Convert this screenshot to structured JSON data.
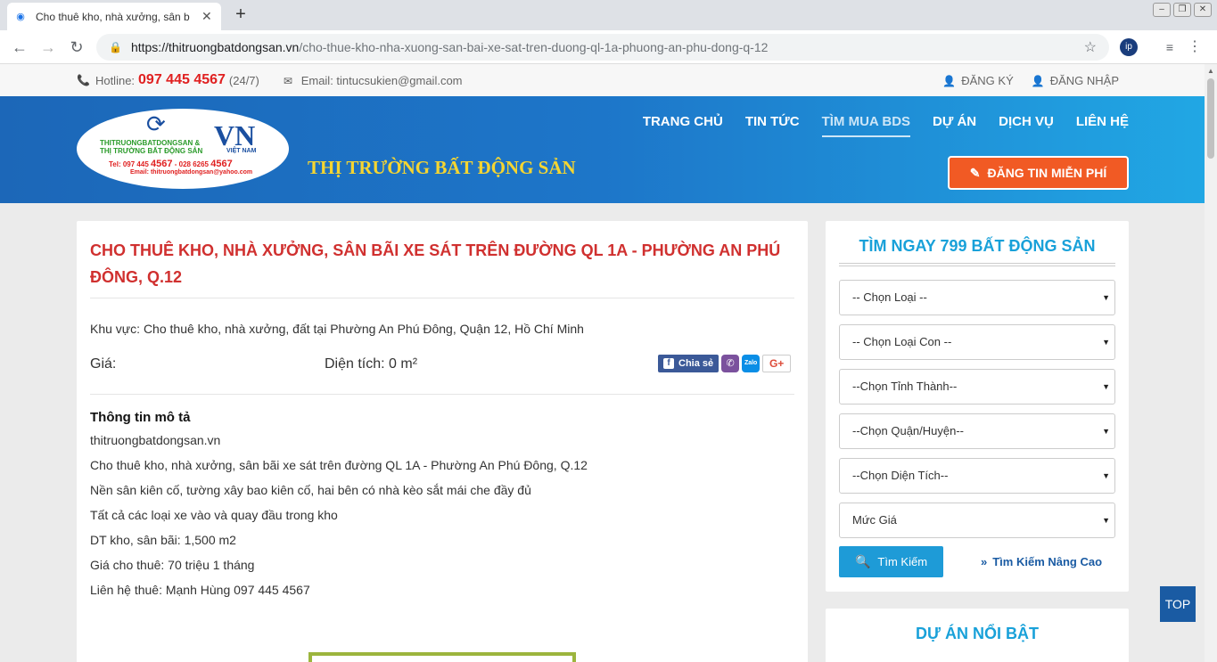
{
  "browser": {
    "tab_title": "Cho thuê kho, nhà xưởng, sân b",
    "url_host": "https://thitruongbatdongsan.vn",
    "url_path": "/cho-thue-kho-nha-xuong-san-bai-xe-sat-tren-duong-ql-1a-phuong-an-phu-dong-q-12",
    "ext_label": "ip"
  },
  "topbar": {
    "hotline_label": "Hotline:",
    "hotline_number": "097 445 4567",
    "hotline_hours": "(24/7)",
    "email_label": "Email: tintucsukien@gmail.com",
    "register": "ĐĂNG KÝ",
    "login": "ĐĂNG NHẬP"
  },
  "header": {
    "logo": {
      "line1": "THITRUONGBATDONGSAN &",
      "line2": "THỊ TRƯỜNG BẤT ĐỘNG SẢN",
      "vn": "VN",
      "vietnam": "VIỆT NAM",
      "tel_prefix": "Tel: 097 445",
      "tel_bold1": "4567",
      "tel_mid": "- 028 6265",
      "tel_bold2": "4567",
      "email": "Email: thitruongbatdongsan@yahoo.com"
    },
    "site_name": "THỊ TRƯỜNG BẤT ĐỘNG SẢN",
    "nav": [
      "TRANG CHỦ",
      "TIN TỨC",
      "TÌM MUA BDS",
      "DỰ ÁN",
      "DỊCH VỤ",
      "LIÊN HỆ"
    ],
    "post_button": "ĐĂNG TIN MIỄN PHÍ"
  },
  "listing": {
    "title": "CHO THUÊ KHO, NHÀ XƯỞNG, SÂN BÃI XE SÁT TRÊN ĐƯỜNG QL 1A - PHƯỜNG AN PHÚ ĐÔNG, Q.12",
    "area": "Khu vực: Cho thuê kho, nhà xưởng, đất tại Phường An Phú Đông, Quận 12, Hồ Chí Minh",
    "price_label": "Giá:",
    "size_label": "Diện tích: 0 m²",
    "share_label": "Chia sẻ",
    "zalo_label": "Zalo",
    "gplus_label": "G+",
    "desc_heading": "Thông tin mô tả",
    "desc_lines": [
      "thitruongbatdongsan.vn",
      "Cho thuê kho, nhà xưởng, sân bãi xe sát trên đường QL 1A - Phường An Phú Đông, Q.12",
      "Nền sân kiên cố, tường xây bao kiên cố, hai bên có nhà kèo sắt mái che đầy đủ",
      "Tất cả các loại xe vào và quay đầu trong kho",
      "DT kho, sân bãi: 1,500 m2",
      "Giá cho thuê: 70 triệu 1 tháng",
      "Liên hệ thuê: Mạnh Hùng 097 445 4567"
    ]
  },
  "sidebar": {
    "search_title": "TÌM NGAY 799 BẤT ĐỘNG SẢN",
    "selects": [
      "-- Chọn Loại --",
      "-- Chọn Loại Con --",
      "--Chọn Tỉnh Thành--",
      "--Chọn Quận/Huyện--",
      "--Chọn Diện Tích--",
      "Mức Giá"
    ],
    "search_button": "Tìm Kiếm",
    "advanced_link": "Tìm Kiếm Nâng Cao",
    "featured_title": "DỰ ÁN NỔI BẬT"
  },
  "top_button": "TOP",
  "colors": {
    "accent_red": "#d0302f",
    "accent_blue": "#19a1d9",
    "cta_orange": "#f15a24",
    "header_blue": "#1d76c9"
  }
}
